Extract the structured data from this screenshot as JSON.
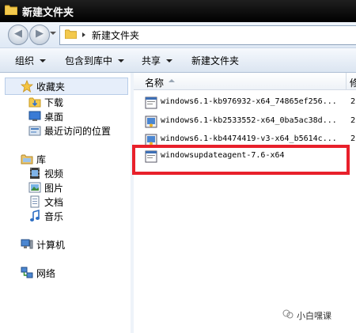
{
  "window": {
    "title": "新建文件夹"
  },
  "navigation": {
    "back_glyph": "◀",
    "forward_glyph": "▶"
  },
  "address": {
    "path": "新建文件夹"
  },
  "toolbar": {
    "organize": "组织",
    "include_in_library": "包含到库中",
    "share": "共享",
    "new_folder": "新建文件夹"
  },
  "nav_pane": {
    "favorites": {
      "label": "收藏夹",
      "icon": "star-icon",
      "items": [
        {
          "label": "下载",
          "icon": "downloads-folder-icon"
        },
        {
          "label": "桌面",
          "icon": "desktop-icon"
        },
        {
          "label": "最近访问的位置",
          "icon": "recent-places-icon"
        }
      ]
    },
    "libraries": {
      "label": "库",
      "icon": "library-icon",
      "items": [
        {
          "label": "视频",
          "icon": "video-icon"
        },
        {
          "label": "图片",
          "icon": "pictures-icon"
        },
        {
          "label": "文档",
          "icon": "documents-icon"
        },
        {
          "label": "音乐",
          "icon": "music-icon"
        }
      ]
    },
    "computer": {
      "label": "计算机",
      "icon": "computer-icon"
    },
    "network": {
      "label": "网络",
      "icon": "network-icon"
    }
  },
  "file_list": {
    "columns": {
      "name": "名称",
      "date": "修"
    },
    "files": [
      {
        "name": "windows6.1-kb976932-x64_74865ef256...",
        "date": "2",
        "icon": "msu-package-icon"
      },
      {
        "name": "windows6.1-kb2533552-x64_0ba5ac38d...",
        "date": "2",
        "icon": "installer-package-icon"
      },
      {
        "name": "windows6.1-kb4474419-v3-x64_b5614c...",
        "date": "2",
        "icon": "installer-package-icon"
      },
      {
        "name": "windowsupdateagent-7.6-x64",
        "date": "",
        "icon": "msu-package-icon"
      }
    ]
  },
  "watermark": {
    "text": "小白嘿课"
  },
  "colors": {
    "highlight_box": "#e8202b",
    "title_bar": "#000000"
  }
}
